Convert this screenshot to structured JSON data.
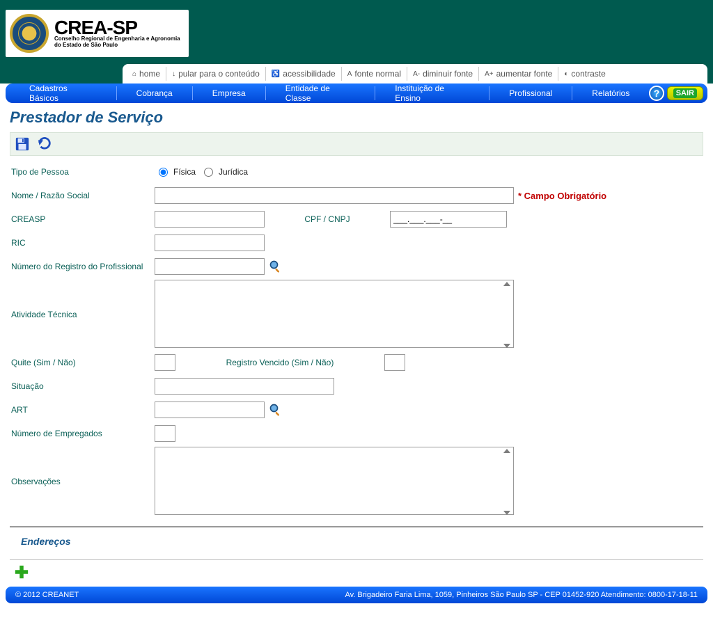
{
  "logo": {
    "title": "CREA-SP",
    "sub1": "Conselho Regional de Engenharia e Agronomia",
    "sub2": "do Estado de São Paulo"
  },
  "access": {
    "home": "home",
    "skip": "pular para o conteúdo",
    "accessibility": "acessibilidade",
    "font_normal": "fonte normal",
    "font_dec": "diminuir fonte",
    "font_inc": "aumentar fonte",
    "contrast": "contraste"
  },
  "nav": {
    "cadastros": "Cadastros Básicos",
    "cobranca": "Cobrança",
    "empresa": "Empresa",
    "entidade": "Entidade de Classe",
    "instituicao": "Instituição de Ensino",
    "profissional": "Profissional",
    "relatorios": "Relatórios",
    "exit": "SAIR",
    "help": "?"
  },
  "page_title": "Prestador de Serviço",
  "form": {
    "tipo_pessoa_label": "Tipo de Pessoa",
    "fisica": "Física",
    "juridica": "Jurídica",
    "nome_label": "Nome / Razão Social",
    "required_text": "* Campo Obrigatório",
    "creasp_label": "CREASP",
    "cpf_label": "CPF / CNPJ",
    "cpf_value": "___.___.___-__",
    "ric_label": "RIC",
    "num_registro_label": "Número do Registro do Profissional",
    "atividade_label": "Atividade Técnica",
    "quite_label": "Quite (Sim / Não)",
    "registro_venc_label": "Registro Vencido (Sim / Não)",
    "situacao_label": "Situação",
    "art_label": "ART",
    "num_empregados_label": "Número de Empregados",
    "observacoes_label": "Observações"
  },
  "section_enderecos": "Endereços",
  "footer": {
    "left": "© 2012 CREANET",
    "right": "Av. Brigadeiro Faria Lima, 1059, Pinheiros São Paulo SP - CEP 01452-920 Atendimento: 0800-17-18-11"
  }
}
